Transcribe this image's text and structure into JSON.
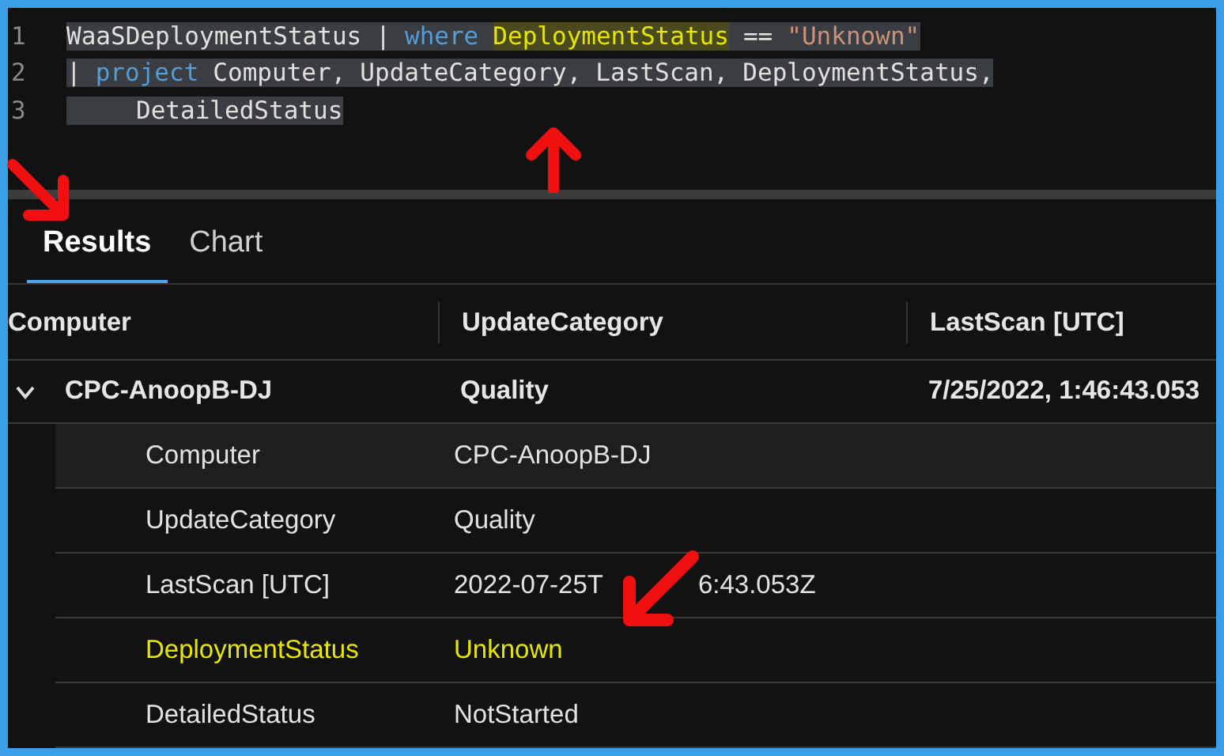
{
  "editor": {
    "lines": [
      {
        "number": "1",
        "indent": false,
        "tokens": [
          {
            "text": "WaaSDeploymentStatus",
            "kind": "plain"
          },
          {
            "text": "|",
            "kind": "plain"
          },
          {
            "text": "where",
            "kind": "keyword"
          },
          {
            "text": "DeploymentStatus",
            "kind": "highlight"
          },
          {
            "text": "==",
            "kind": "plain"
          },
          {
            "text": "\"Unknown\"",
            "kind": "string"
          }
        ]
      },
      {
        "number": "2",
        "indent": false,
        "tokens": [
          {
            "text": "|",
            "kind": "plain"
          },
          {
            "text": "project",
            "kind": "keyword"
          },
          {
            "text": "Computer,",
            "kind": "plain"
          },
          {
            "text": "UpdateCategory,",
            "kind": "plain"
          },
          {
            "text": "LastScan,",
            "kind": "plain"
          },
          {
            "text": "DeploymentStatus,",
            "kind": "plain"
          }
        ]
      },
      {
        "number": "3",
        "indent": true,
        "tokens": [
          {
            "text": "DetailedStatus",
            "kind": "plain"
          }
        ]
      }
    ]
  },
  "tabs": [
    {
      "label": "Results",
      "selected": true
    },
    {
      "label": "Chart",
      "selected": false
    }
  ],
  "table": {
    "columns": [
      "Computer",
      "UpdateCategory",
      "LastScan [UTC]"
    ],
    "group": {
      "expanded": true,
      "cells": [
        "CPC-AnoopB-DJ",
        "Quality",
        "7/25/2022, 1:46:43.053"
      ],
      "details": [
        {
          "label": "Computer",
          "value_parts": [
            "CPC-AnoopB-DJ"
          ],
          "highlighted": false
        },
        {
          "label": "UpdateCategory",
          "value_parts": [
            "Quality"
          ],
          "highlighted": false
        },
        {
          "label": "LastScan [UTC]",
          "value_parts": [
            "2022-07-25T",
            "6:43.053Z"
          ],
          "highlighted": false
        },
        {
          "label": "DeploymentStatus",
          "value_parts": [
            "Unknown"
          ],
          "highlighted": true
        },
        {
          "label": "DetailedStatus",
          "value_parts": [
            "NotStarted"
          ],
          "highlighted": false
        }
      ]
    }
  }
}
